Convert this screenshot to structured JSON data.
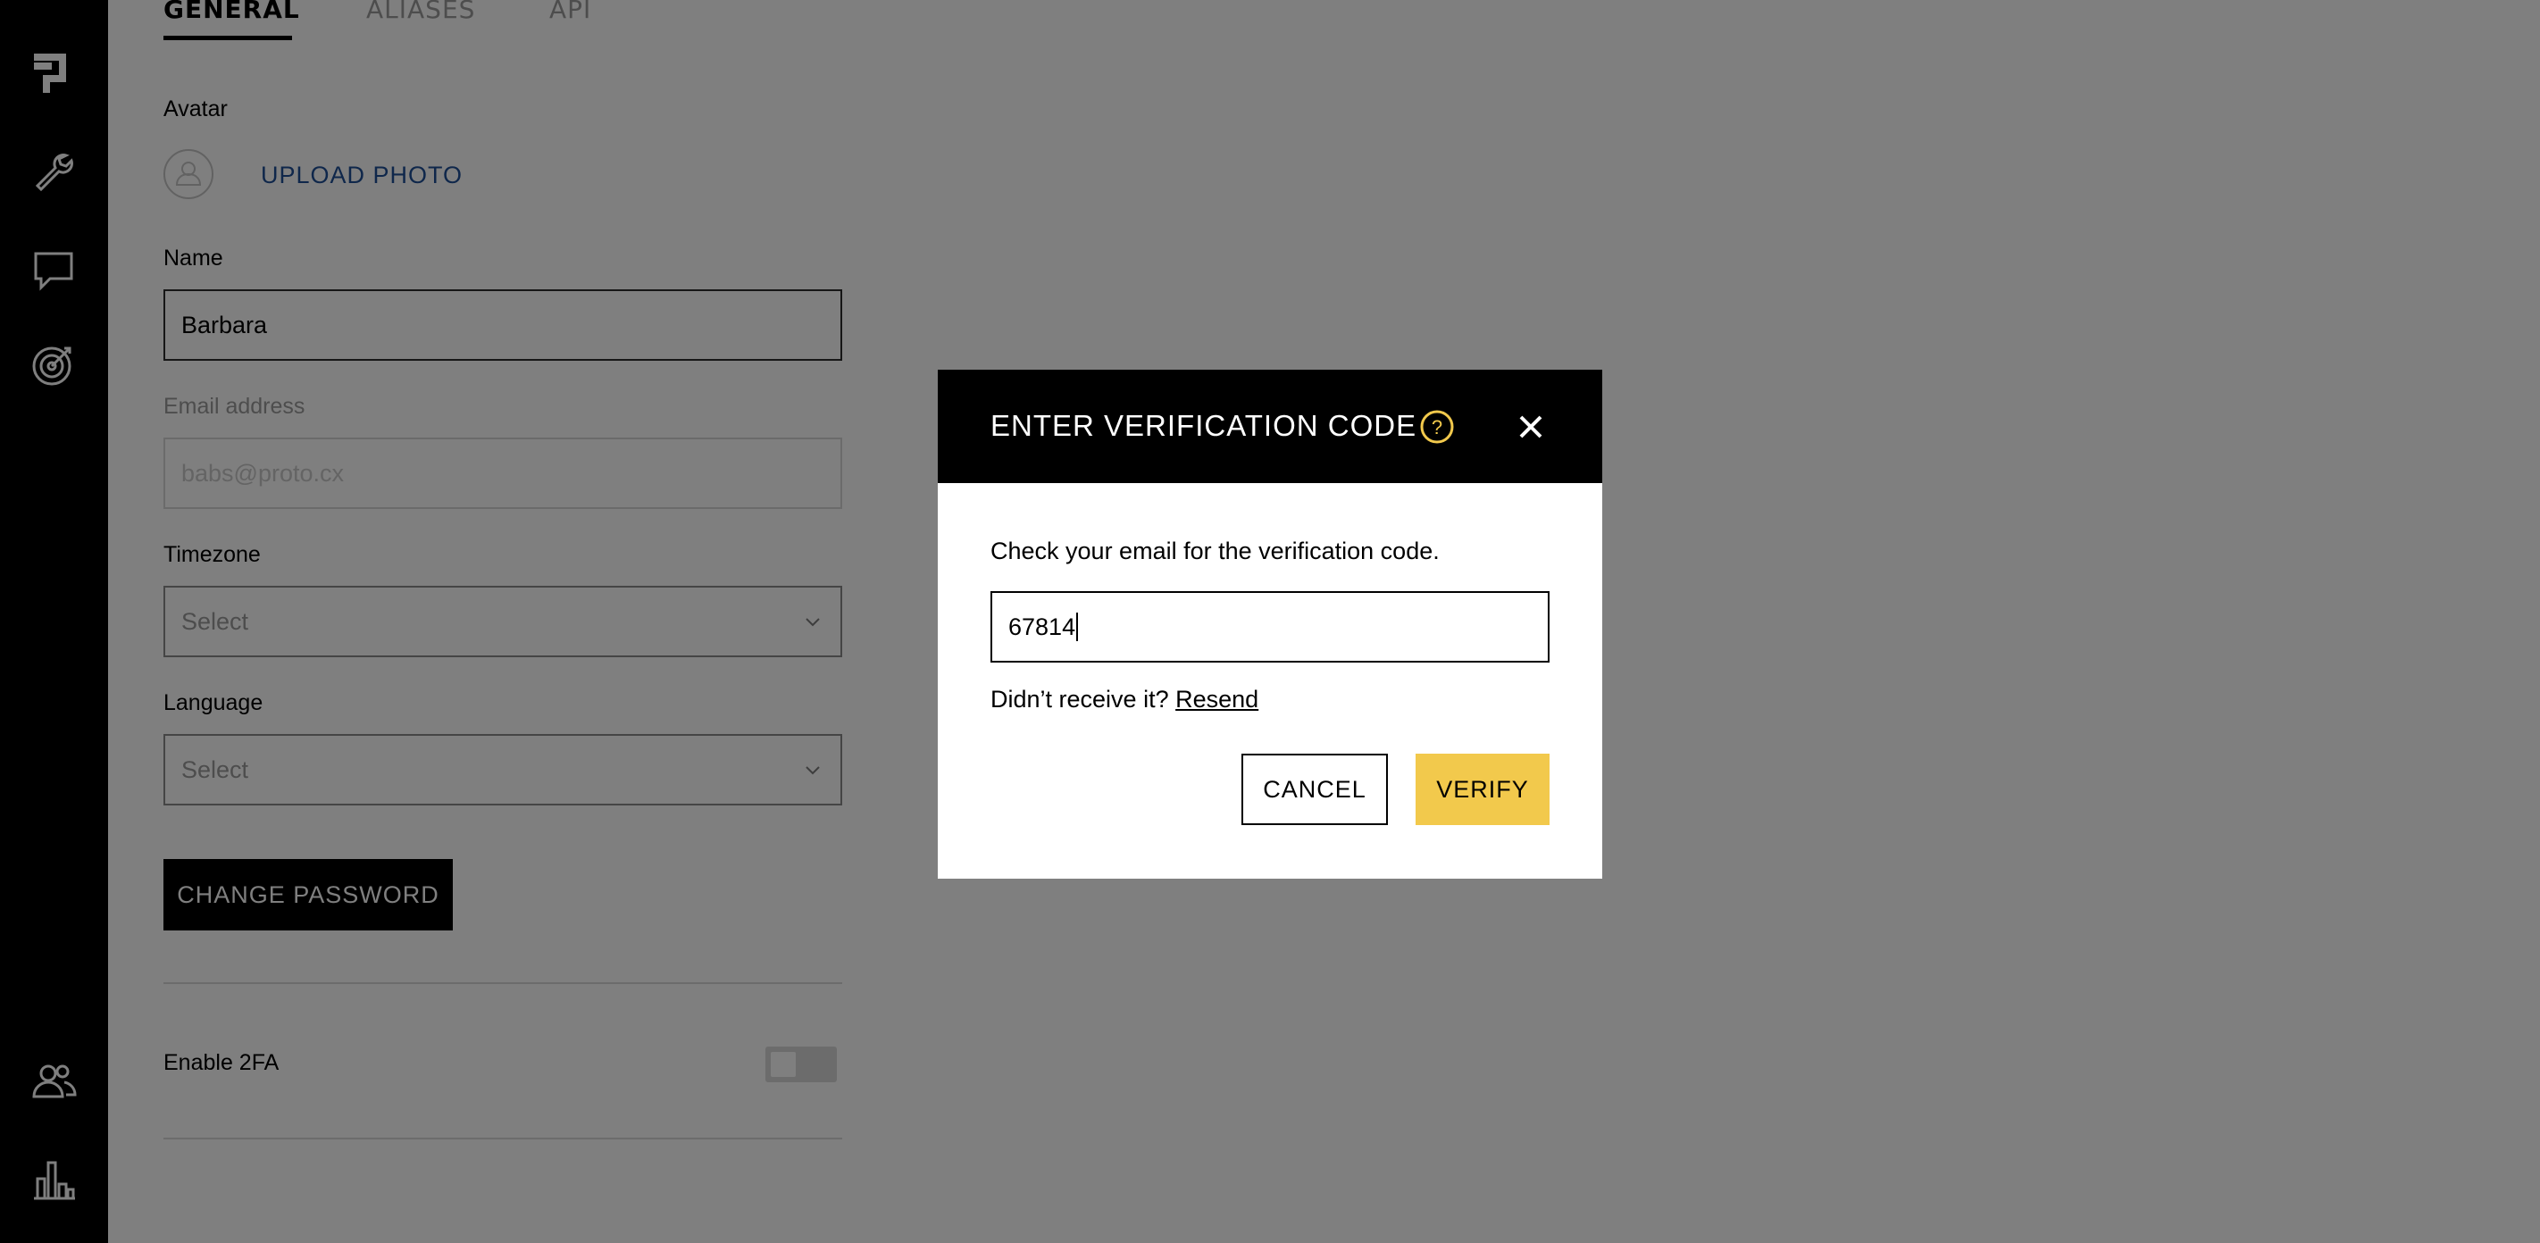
{
  "sidebar": {
    "icons": [
      "logo-icon",
      "wrench-icon",
      "chat-icon",
      "target-icon",
      "users-icon",
      "bar-chart-icon"
    ]
  },
  "tabs": [
    {
      "label": "GENERAL",
      "active": true
    },
    {
      "label": "ALIASES",
      "active": false
    },
    {
      "label": "API",
      "active": false
    }
  ],
  "profile": {
    "avatar_label": "Avatar",
    "upload_label": "UPLOAD PHOTO",
    "name_label": "Name",
    "name_value": "Barbara",
    "email_label": "Email address",
    "email_value": "babs@proto.cx",
    "timezone_label": "Timezone",
    "timezone_value": "Select",
    "language_label": "Language",
    "language_value": "Select",
    "change_password_label": "CHANGE PASSWORD",
    "enable_2fa_label": "Enable 2FA",
    "enable_2fa_on": false
  },
  "modal": {
    "title": "ENTER VERIFICATION CODE",
    "instructions": "Check your email for the verification code.",
    "code_value": "67814",
    "resend_prompt": "Didn’t receive it?",
    "resend_link": "Resend",
    "cancel_label": "CANCEL",
    "verify_label": "VERIFY"
  },
  "colors": {
    "sidebar_bg": "#000000",
    "accent_yellow": "#f2c94c",
    "link_blue": "#1e4f96",
    "overlay": "rgba(0,0,0,0.5)"
  }
}
